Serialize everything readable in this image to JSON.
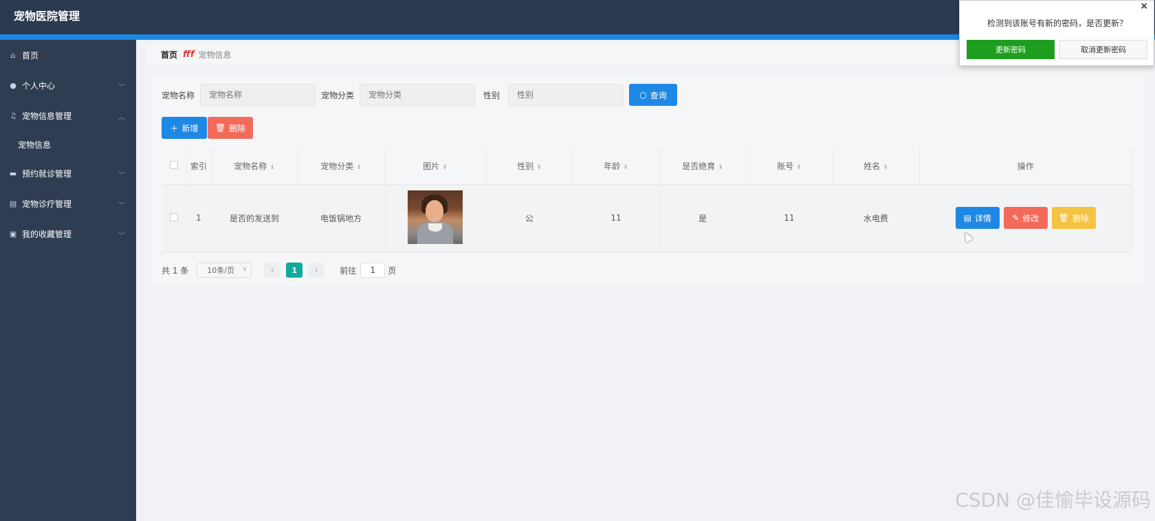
{
  "app": {
    "title": "宠物医院管理"
  },
  "sidebar": {
    "items": [
      {
        "label": "首页",
        "icon": "home-icon",
        "expandable": false
      },
      {
        "label": "个人中心",
        "icon": "user-icon",
        "expandable": true
      },
      {
        "label": "宠物信息管理",
        "icon": "bell-icon",
        "expandable": true,
        "expanded": true
      },
      {
        "label": "预约就诊管理",
        "icon": "briefcase-icon",
        "expandable": true
      },
      {
        "label": "宠物诊疗管理",
        "icon": "document-icon",
        "expandable": true
      },
      {
        "label": "我的收藏管理",
        "icon": "clipboard-icon",
        "expandable": true
      }
    ],
    "sub_items": [
      {
        "label": "宠物信息"
      }
    ]
  },
  "breadcrumb": {
    "home": "首页",
    "separator": "fff",
    "current": "宠物信息"
  },
  "search": {
    "fields": [
      {
        "label": "宠物名称",
        "placeholder": "宠物名称"
      },
      {
        "label": "宠物分类",
        "placeholder": "宠物分类"
      },
      {
        "label": "性别",
        "placeholder": "性别"
      }
    ],
    "button": "查询"
  },
  "actions": {
    "add": "新增",
    "delete": "删除"
  },
  "table": {
    "headers": [
      "索引",
      "宠物名称",
      "宠物分类",
      "图片",
      "性别",
      "年龄",
      "是否绝育",
      "账号",
      "姓名",
      "操作"
    ],
    "rows": [
      {
        "index": "1",
        "name": "是否的发送到",
        "category": "电饭锅地方",
        "gender": "公",
        "age": "11",
        "neutered": "是",
        "account": "11",
        "owner": "水电费"
      }
    ],
    "row_actions": {
      "detail": "详情",
      "edit": "修改",
      "delete": "删除"
    }
  },
  "pagination": {
    "total": "共 1 条",
    "page_size": "10条/页",
    "current_page": "1",
    "goto_label": "前往",
    "goto_value": "1",
    "page_unit": "页"
  },
  "dialog": {
    "message": "检测到该账号有新的密码，是否更新？",
    "confirm": "更新密码",
    "cancel": "取消更新密码",
    "close": "×"
  },
  "watermark": "CSDN @佳愉毕设源码",
  "colors": {
    "topbar": "#2b3a4f",
    "sidebar": "#2f3d52",
    "accent_blue": "#1e88e5",
    "danger": "#f26a5a",
    "warning": "#f5c242",
    "pager_active": "#13a89e",
    "dialog_confirm": "#1e9e1e"
  }
}
